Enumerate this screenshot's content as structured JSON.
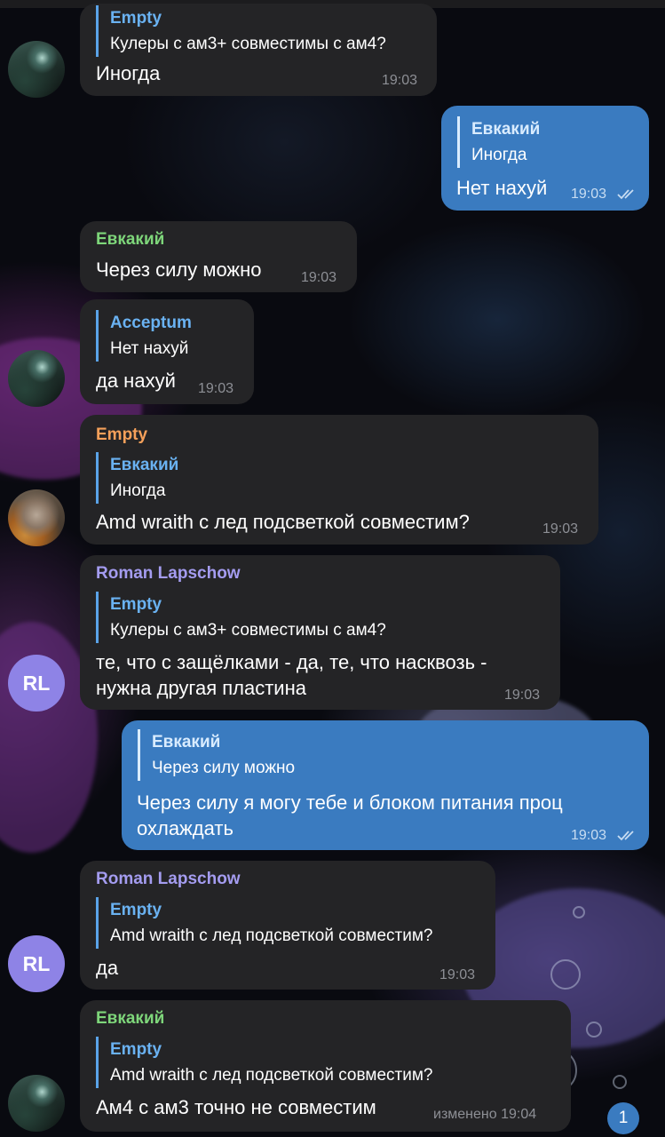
{
  "messages": [
    {
      "id": "m1",
      "reply": {
        "name": "Empty",
        "text": "Кулеры с ам3+ совместимы с ам4?"
      },
      "text": "Иногда",
      "time": "19:03"
    },
    {
      "id": "m2",
      "outgoing": true,
      "reply": {
        "name": "Евкакий",
        "text": "Иногда"
      },
      "text": "Нет нахуй",
      "time": "19:03"
    },
    {
      "id": "m3",
      "sender": "Евкакий",
      "text": "Через силу можно",
      "time": "19:03"
    },
    {
      "id": "m4",
      "reply": {
        "name": "Acceptum",
        "text": "Нет нахуй"
      },
      "text": "да нахуй",
      "time": "19:03"
    },
    {
      "id": "m5",
      "sender": "Empty",
      "reply": {
        "name": "Евкакий",
        "text": "Иногда"
      },
      "text": "Amd wraith с лед подсветкой совместим?",
      "time": "19:03"
    },
    {
      "id": "m6",
      "sender": "Roman Lapschow",
      "avatar_initials": "RL",
      "reply": {
        "name": "Empty",
        "text": "Кулеры с ам3+ совместимы с ам4?"
      },
      "text_lines": [
        "те, что с защёлками - да, те, что насквозь -",
        "нужна другая пластина"
      ],
      "time": "19:03"
    },
    {
      "id": "m7",
      "outgoing": true,
      "reply": {
        "name": "Евкакий",
        "text": "Через силу можно"
      },
      "text_lines": [
        "Через силу я могу тебе и блоком питания проц",
        "охлаждать"
      ],
      "time": "19:03"
    },
    {
      "id": "m8",
      "sender": "Roman Lapschow",
      "avatar_initials": "RL",
      "reply": {
        "name": "Empty",
        "text": "Amd wraith с лед подсветкой совместим?"
      },
      "text": "да",
      "time": "19:03"
    },
    {
      "id": "m9",
      "sender": "Евкакий",
      "reply": {
        "name": "Empty",
        "text": "Amd wraith с лед подсветкой совместим?"
      },
      "text": "Ам4 с ам3 точно не совместим",
      "time": "изменено 19:04"
    }
  ],
  "unread_badge": "1",
  "colors": {
    "incoming_bubble": "#242426",
    "outgoing_bubble": "#3a7bc0",
    "sender_evkakiy": "#7ed67a",
    "sender_empty": "#f5a05a",
    "sender_roman": "#a49cf0",
    "reply_name": "#6ab2f2",
    "avatar_rl": "#8e83e6"
  }
}
